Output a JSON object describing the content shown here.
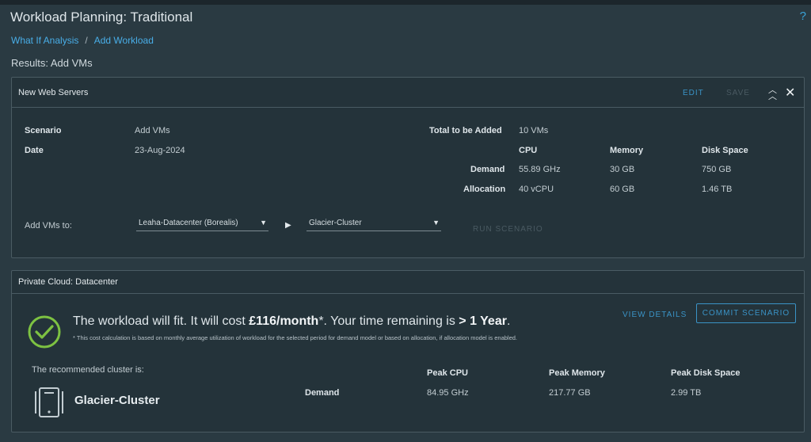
{
  "page": {
    "title": "Workload Planning: Traditional",
    "help": "?",
    "breadcrumb": [
      "What If Analysis",
      "/",
      "Add Workload"
    ],
    "results_title": "Results: Add VMs"
  },
  "scenario_card": {
    "title": "New Web Servers",
    "edit_label": "EDIT",
    "save_label": "SAVE",
    "scenario_label": "Scenario",
    "scenario_value": "Add VMs",
    "date_label": "Date",
    "date_value": "23-Aug-2024",
    "total_label": "Total to be Added",
    "total_value": "10 VMs",
    "columns": [
      "CPU",
      "Memory",
      "Disk Space"
    ],
    "demand": {
      "label": "Demand",
      "cpu": "55.89 GHz",
      "memory": "30 GB",
      "disk": "750 GB"
    },
    "allocation": {
      "label": "Allocation",
      "cpu": "40 vCPU",
      "memory": "60 GB",
      "disk": "1.46 TB"
    },
    "add_to_label": "Add VMs to:",
    "datacenter_select": "Leaha-Datacenter (Borealis)",
    "cluster_select": "Glacier-Cluster",
    "run_label": "RUN SCENARIO"
  },
  "result_card": {
    "title": "Private Cloud: Datacenter",
    "msg_a": "The workload will fit. It will cost ",
    "cost": "£116/month",
    "msg_b": "*. Your time remaining is ",
    "remaining": "> 1 Year",
    "msg_c": ".",
    "note": "* This cost calculation is based on monthly average utilization of workload for the selected period for demand model or based on allocation, if allocation model is enabled.",
    "view_details_label": "VIEW DETAILS",
    "commit_label": "COMMIT SCENARIO",
    "recommended_label": "The recommended cluster is:",
    "cluster_name": "Glacier-Cluster",
    "peak_columns": [
      "Peak CPU",
      "Peak Memory",
      "Peak Disk Space"
    ],
    "demand_label": "Demand",
    "peak_cpu": "84.95 GHz",
    "peak_memory": "217.77 GB",
    "peak_disk": "2.99 TB"
  },
  "colors": {
    "accent": "#3a93c6",
    "background": "#2a3a42",
    "success": "#7dc242"
  },
  "icons": {
    "success": "check-circle-icon",
    "cluster": "device-icon",
    "collapse": "double-chevron-up-icon",
    "close": "close-icon",
    "run": "play-icon"
  }
}
